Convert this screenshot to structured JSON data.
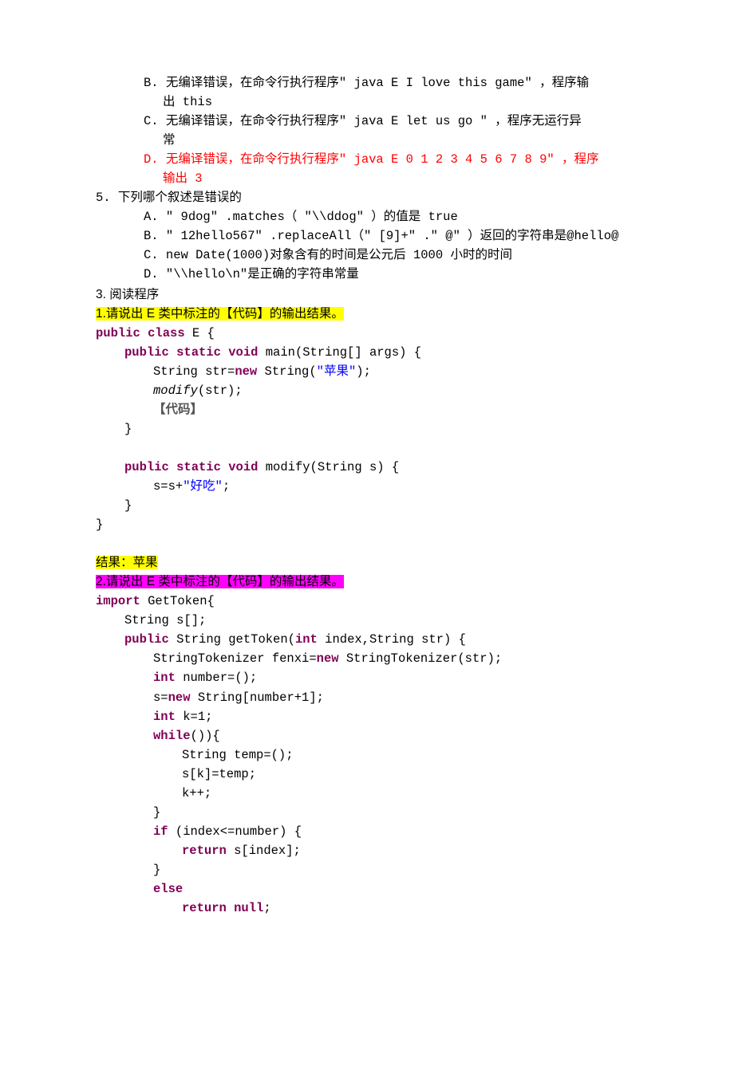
{
  "q4": {
    "B": {
      "label": "B.",
      "line1": "无编译错误，在命令行执行程序\" java E I love this game\" ，程序输",
      "line2": "出 this"
    },
    "C": {
      "label": "C.",
      "line1": "无编译错误，在命令行执行程序\" java E let us go \" ，程序无运行异",
      "line2": "常"
    },
    "D": {
      "label": "D.",
      "line1": "无编译错误，在命令行执行程序\" java E 0 1 2 3 4 5 6 7 8 9\" ，程序",
      "line2": "输出 3"
    }
  },
  "q5": {
    "num": "5.",
    "stem": "下列哪个叙述是错误的",
    "A": {
      "label": "A.",
      "text": "\" 9dog\" .matches（ \"\\\\ddog\" ）的值是 true"
    },
    "B": {
      "label": "B.",
      "text": "\" 12hello567\" .replaceAll（\" [9]+\" .\" @\" ）返回的字符串是@hello@"
    },
    "C": {
      "label": "C.",
      "text": "new Date(1000)对象含有的时间是公元后 1000 小时的时间"
    },
    "D": {
      "label": "D.",
      "text": "\"\\\\hello\\n\"是正确的字符串常量"
    }
  },
  "sec3": "3. 阅读程序",
  "p1": {
    "heading": "1.请说出 E 类中标注的【代码】的输出结果。"
  },
  "code1": {
    "l1_kw1": "public class ",
    "l1_name": "E {",
    "l2_kw": "public static void ",
    "l2_rest": "main(String[] args) {",
    "l3a": "String str=",
    "l3_kw": "new ",
    "l3b": "String(",
    "l3_str": "\"苹果\"",
    "l3c": ");",
    "l4a": "modify",
    "l4b": "(str);",
    "l5": "【代码】",
    "l6": "}",
    "l7_kw": "public static void ",
    "l7_rest": "modify(String s) {",
    "l8a": "s=s+",
    "l8_str": "\"好吃\"",
    "l8b": ";",
    "l9": "}",
    "l10": "}"
  },
  "result1": "结果：苹果",
  "p2": {
    "heading": "2.请说出 E 类中标注的【代码】的输出结果。"
  },
  "code2": {
    "l1_kw": "import",
    "l1_rest": "  GetToken{",
    "l2": "String s[];",
    "l3_kw": "public ",
    "l3a": "String getToken(",
    "l3_kw2": "int ",
    "l3b": "index,String str) {",
    "l4a": "StringTokenizer fenxi=",
    "l4_kw": "new ",
    "l4b": "StringTokenizer(str);",
    "l5_kw": "int ",
    "l5a": "number=();",
    "l6a": "s=",
    "l6_kw": "new ",
    "l6b": "String[number+1];",
    "l7_kw": "int ",
    "l7a": "k=1;",
    "l8_kw": "while",
    "l8a": "()){",
    "l9": "String temp=();",
    "l10": "s[k]=temp;",
    "l11": "k++;",
    "l12": "}",
    "l13_kw": "if ",
    "l13a": "(index<=number) {",
    "l14_kw": "return ",
    "l14a": "s[index];",
    "l15": "}",
    "l16_kw": "else",
    "l17_kw": "return null",
    "l17a": ";"
  }
}
